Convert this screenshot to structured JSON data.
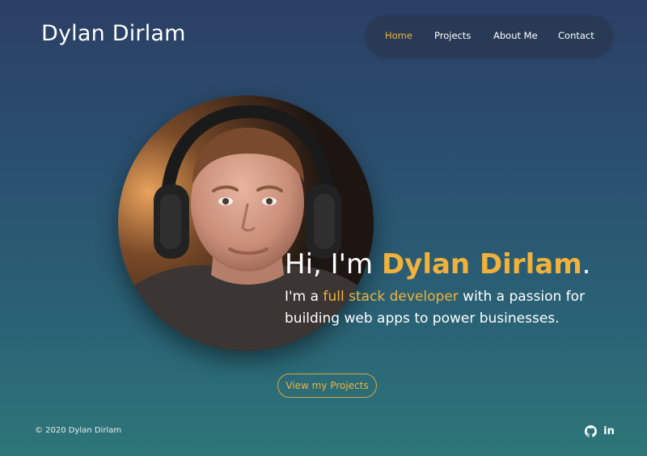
{
  "header": {
    "brand": "Dylan Dirlam"
  },
  "nav": {
    "items": [
      {
        "label": "Home",
        "active": true
      },
      {
        "label": "Projects",
        "active": false
      },
      {
        "label": "About Me",
        "active": false
      },
      {
        "label": "Contact",
        "active": false
      }
    ]
  },
  "hero": {
    "title_prefix": "Hi, I'm ",
    "title_name": "Dylan Dirlam",
    "title_suffix": ".",
    "subtitle_pre": "I'm a ",
    "subtitle_highlight": "full stack developer",
    "subtitle_post": " with a passion for building web apps to power businesses.",
    "cta_label": "View my Projects"
  },
  "footer": {
    "copyright": "© 2020 Dylan Dirlam",
    "social": [
      {
        "icon": "github-icon"
      },
      {
        "icon": "linkedin-icon",
        "label": "in"
      }
    ]
  },
  "colors": {
    "accent": "#f0b23a",
    "background_top": "#2b3f64",
    "background_bottom": "#2d7679",
    "nav_background": "#283852"
  }
}
